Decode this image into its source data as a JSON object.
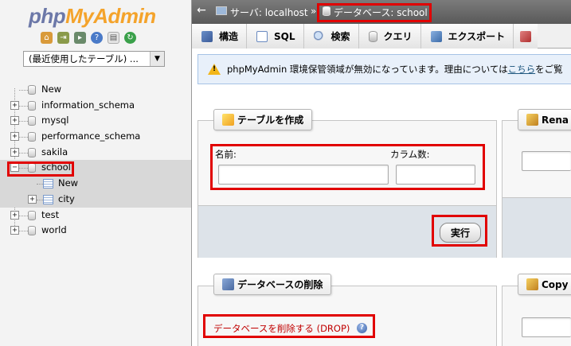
{
  "nav": {
    "logo_php": "php",
    "logo_admin": "MyAdmin",
    "icons": [
      "home-icon",
      "exit-icon",
      "query-window-icon",
      "help-icon",
      "docs-icon",
      "reload-icon"
    ],
    "recent_select": "(最近使用したテーブル) ...",
    "tree": [
      {
        "label": "New",
        "type": "new"
      },
      {
        "label": "information_schema",
        "type": "db"
      },
      {
        "label": "mysql",
        "type": "db"
      },
      {
        "label": "performance_schema",
        "type": "db"
      },
      {
        "label": "sakila",
        "type": "db"
      },
      {
        "label": "school",
        "type": "db",
        "selected": true
      },
      {
        "label": "New",
        "type": "new-table"
      },
      {
        "label": "city",
        "type": "table"
      },
      {
        "label": "test",
        "type": "db"
      },
      {
        "label": "world",
        "type": "db"
      }
    ]
  },
  "topbar": {
    "server": "サーバ: localhost",
    "separator": "»",
    "database": "データベース: school"
  },
  "tabs": [
    {
      "label": "構造",
      "icon": "structure-icon"
    },
    {
      "label": "SQL",
      "icon": "sql-icon"
    },
    {
      "label": "検索",
      "icon": "search-icon"
    },
    {
      "label": "クエリ",
      "icon": "query-icon"
    },
    {
      "label": "エクスポート",
      "icon": "export-icon"
    }
  ],
  "notice": {
    "text_before": "phpMyAdmin 環境保管領域が無効になっています。理由については",
    "link": "こちら",
    "text_after": "をご覧"
  },
  "create_table": {
    "title": "テーブルを作成",
    "name_label": "名前:",
    "columns_label": "カラム数:",
    "name_value": "",
    "columns_value": "",
    "submit": "実行"
  },
  "drop_db": {
    "title": "データベースの削除",
    "link": "データベースを削除する (DROP)"
  },
  "rename_panel": {
    "title": "Rena"
  },
  "copy_panel": {
    "title": "Copy"
  }
}
